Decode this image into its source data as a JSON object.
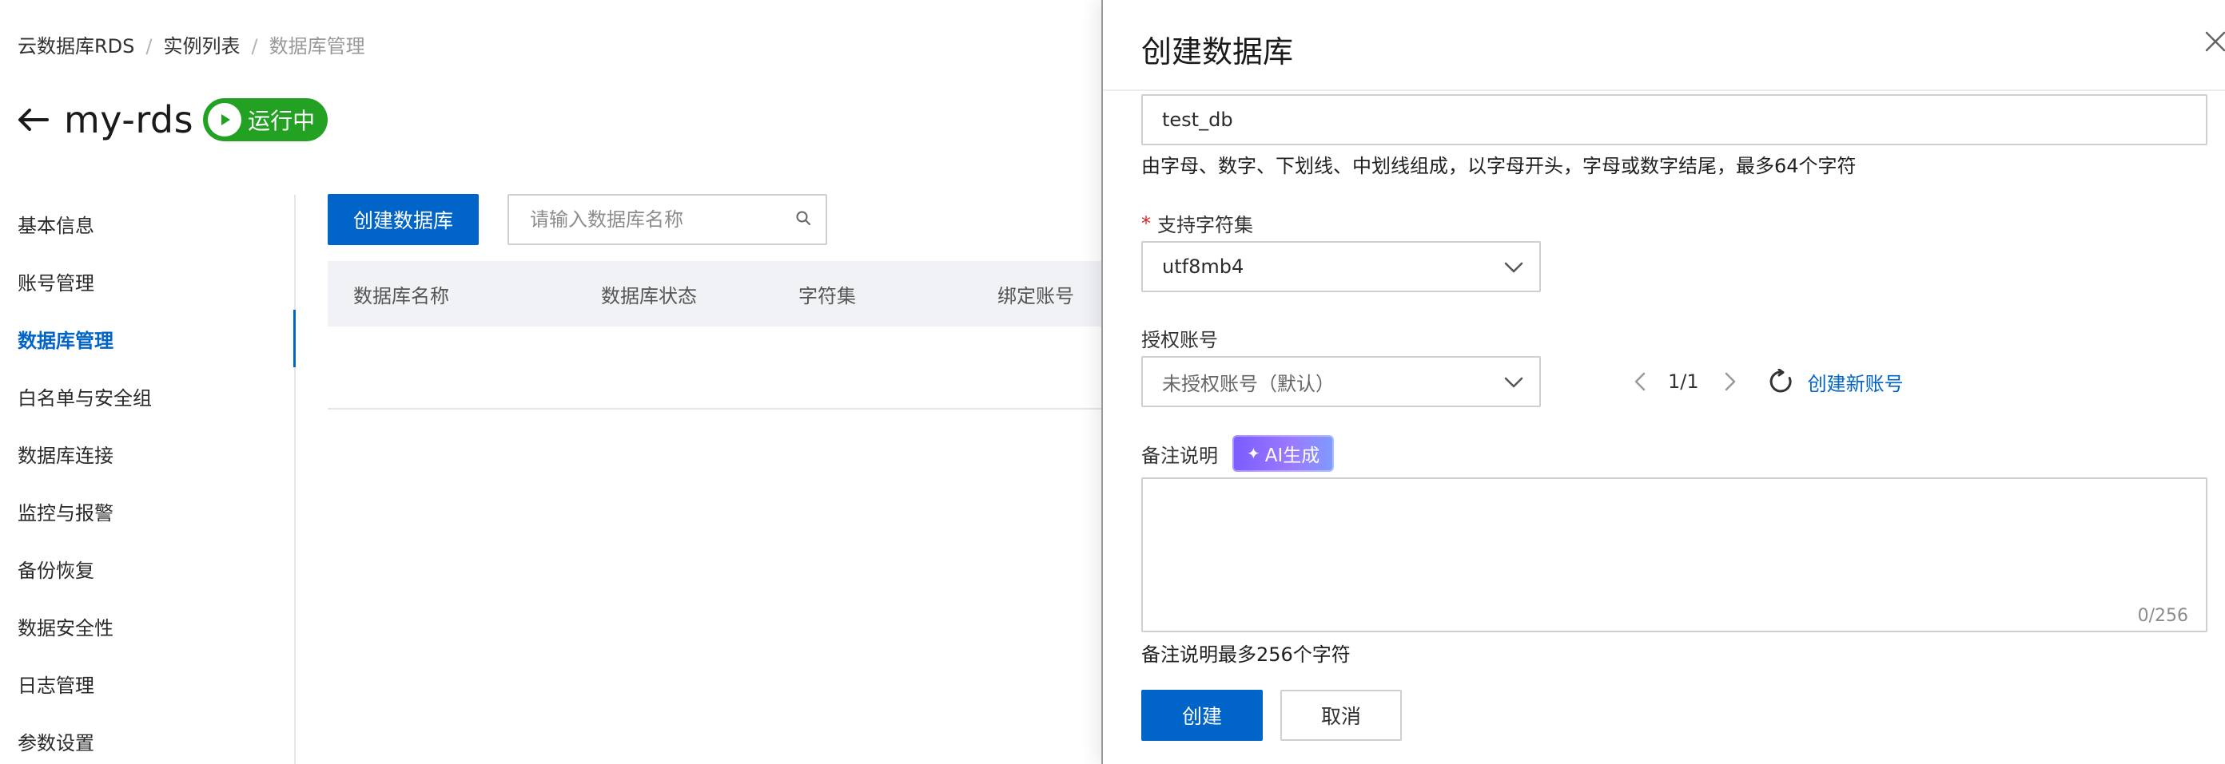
{
  "breadcrumb": {
    "items": [
      "云数据库RDS",
      "实例列表",
      "数据库管理"
    ]
  },
  "instance": {
    "name": "my-rds",
    "status": "运行中",
    "status_color": "#23a123"
  },
  "sidebar": {
    "items": [
      {
        "label": "基本信息"
      },
      {
        "label": "账号管理"
      },
      {
        "label": "数据库管理"
      },
      {
        "label": "白名单与安全组"
      },
      {
        "label": "数据库连接"
      },
      {
        "label": "监控与报警"
      },
      {
        "label": "备份恢复"
      },
      {
        "label": "数据安全性"
      },
      {
        "label": "日志管理"
      },
      {
        "label": "参数设置"
      }
    ],
    "active_index": 2
  },
  "toolbar": {
    "create_label": "创建数据库",
    "search_placeholder": "请输入数据库名称"
  },
  "table": {
    "columns": [
      "数据库名称",
      "数据库状态",
      "字符集",
      "绑定账号"
    ]
  },
  "drawer": {
    "title": "创建数据库",
    "db_name_value": "test_db",
    "db_name_help": "由字母、数字、下划线、中划线组成，以字母开头，字母或数字结尾，最多64个字符",
    "charset": {
      "required_mark": "*",
      "label": "支持字符集",
      "value": "utf8mb4"
    },
    "account": {
      "label": "授权账号",
      "value": "未授权账号（默认）",
      "pager": "1/1",
      "create_link": "创建新账号"
    },
    "remark": {
      "label": "备注说明",
      "ai_button": "AI生成",
      "counter": "0/256",
      "help": "备注说明最多256个字符"
    },
    "submit_label": "创建",
    "cancel_label": "取消"
  },
  "colors": {
    "primary": "#0064c8",
    "ai_gradient_start": "#7b5cff"
  }
}
